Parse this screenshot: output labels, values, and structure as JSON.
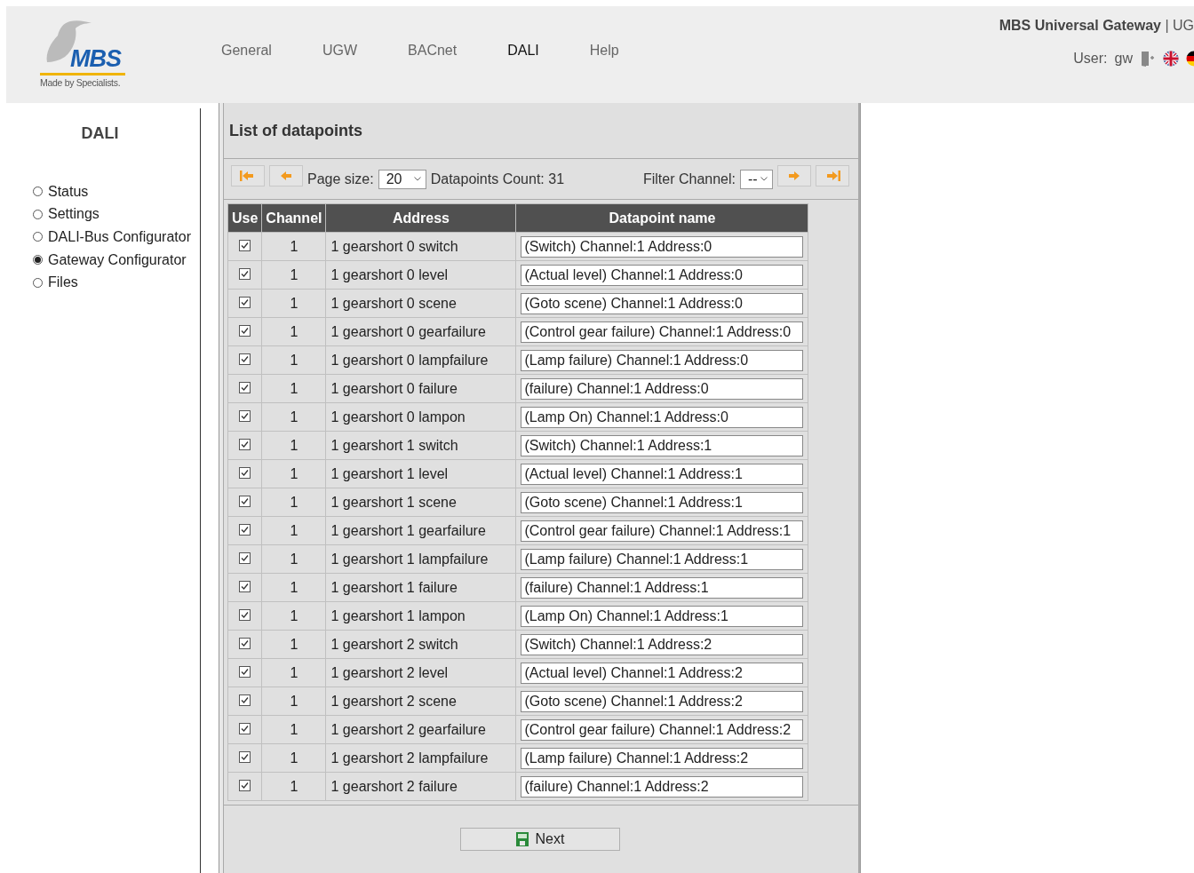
{
  "header": {
    "logo": {
      "brand": "MBS",
      "tagline": "Made by Specialists."
    },
    "nav": [
      {
        "label": "General",
        "selected": false
      },
      {
        "label": "UGW",
        "selected": false
      },
      {
        "label": "BACnet",
        "selected": false
      },
      {
        "label": "DALI",
        "selected": true
      },
      {
        "label": "Help",
        "selected": false
      }
    ],
    "product": "MBS Universal Gateway",
    "product_suffix": "| UG",
    "user_label": "User:",
    "user": "gw"
  },
  "sidebar": {
    "title": "DALI",
    "items": [
      {
        "label": "Status",
        "selected": false
      },
      {
        "label": "Settings",
        "selected": false
      },
      {
        "label": "DALI-Bus Configurator",
        "selected": false
      },
      {
        "label": "Gateway Configurator",
        "selected": true
      },
      {
        "label": "Files",
        "selected": false
      }
    ]
  },
  "panel": {
    "title": "List of datapoints",
    "page_size_label": "Page size:",
    "page_size": "20",
    "count_label": "Datapoints Count:",
    "count": "31",
    "filter_label": "Filter Channel:",
    "filter": "--",
    "columns": [
      "Use",
      "Channel",
      "Address",
      "Datapoint name"
    ],
    "rows": [
      {
        "use": true,
        "channel": "1",
        "address": "1 gearshort 0 switch",
        "name": "(Switch) Channel:1 Address:0"
      },
      {
        "use": true,
        "channel": "1",
        "address": "1 gearshort 0 level",
        "name": "(Actual level) Channel:1 Address:0"
      },
      {
        "use": true,
        "channel": "1",
        "address": "1 gearshort 0 scene",
        "name": "(Goto scene) Channel:1 Address:0"
      },
      {
        "use": true,
        "channel": "1",
        "address": "1 gearshort 0 gearfailure",
        "name": "(Control gear failure) Channel:1 Address:0"
      },
      {
        "use": true,
        "channel": "1",
        "address": "1 gearshort 0 lampfailure",
        "name": "(Lamp failure) Channel:1 Address:0"
      },
      {
        "use": true,
        "channel": "1",
        "address": "1 gearshort 0 failure",
        "name": "(failure) Channel:1 Address:0"
      },
      {
        "use": true,
        "channel": "1",
        "address": "1 gearshort 0 lampon",
        "name": "(Lamp On) Channel:1 Address:0"
      },
      {
        "use": true,
        "channel": "1",
        "address": "1 gearshort 1 switch",
        "name": "(Switch) Channel:1 Address:1"
      },
      {
        "use": true,
        "channel": "1",
        "address": "1 gearshort 1 level",
        "name": "(Actual level) Channel:1 Address:1"
      },
      {
        "use": true,
        "channel": "1",
        "address": "1 gearshort 1 scene",
        "name": "(Goto scene) Channel:1 Address:1"
      },
      {
        "use": true,
        "channel": "1",
        "address": "1 gearshort 1 gearfailure",
        "name": "(Control gear failure) Channel:1 Address:1"
      },
      {
        "use": true,
        "channel": "1",
        "address": "1 gearshort 1 lampfailure",
        "name": "(Lamp failure) Channel:1 Address:1"
      },
      {
        "use": true,
        "channel": "1",
        "address": "1 gearshort 1 failure",
        "name": "(failure) Channel:1 Address:1"
      },
      {
        "use": true,
        "channel": "1",
        "address": "1 gearshort 1 lampon",
        "name": "(Lamp On) Channel:1 Address:1"
      },
      {
        "use": true,
        "channel": "1",
        "address": "1 gearshort 2 switch",
        "name": "(Switch) Channel:1 Address:2"
      },
      {
        "use": true,
        "channel": "1",
        "address": "1 gearshort 2 level",
        "name": "(Actual level) Channel:1 Address:2"
      },
      {
        "use": true,
        "channel": "1",
        "address": "1 gearshort 2 scene",
        "name": "(Goto scene) Channel:1 Address:2"
      },
      {
        "use": true,
        "channel": "1",
        "address": "1 gearshort 2 gearfailure",
        "name": "(Control gear failure) Channel:1 Address:2"
      },
      {
        "use": true,
        "channel": "1",
        "address": "1 gearshort 2 lampfailure",
        "name": "(Lamp failure) Channel:1 Address:2"
      },
      {
        "use": true,
        "channel": "1",
        "address": "1 gearshort 2 failure",
        "name": "(failure) Channel:1 Address:2"
      }
    ],
    "next_button": "Next"
  }
}
